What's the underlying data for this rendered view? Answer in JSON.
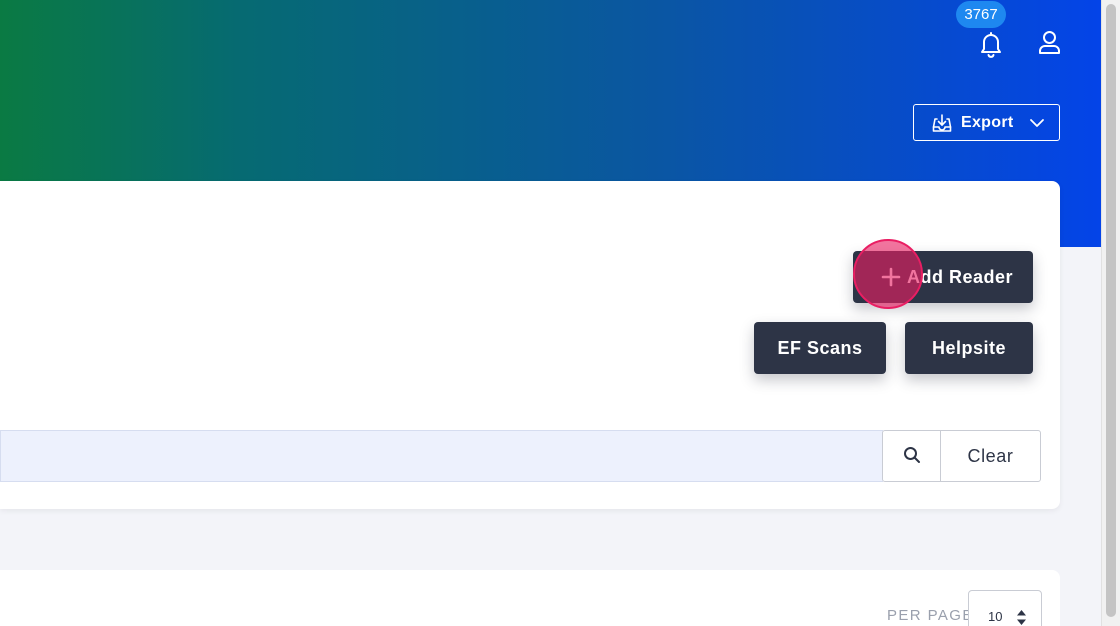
{
  "header": {
    "notification_count": "3767",
    "export_label": "Export"
  },
  "actions": {
    "add_reader_label": "Add Reader",
    "ef_scans_label": "EF Scans",
    "helpsite_label": "Helpsite"
  },
  "search": {
    "value": "",
    "placeholder": "",
    "clear_label": "Clear"
  },
  "pagination": {
    "per_page_label": "PER PAGE",
    "per_page_value": "10"
  },
  "colors": {
    "primary_dark": "#2d3446",
    "badge_blue": "#1e88f0",
    "click_highlight": "#e91e63",
    "search_bg": "#edf1fd"
  },
  "icons": [
    "bell-icon",
    "user-icon",
    "download-icon",
    "chevron-down-icon",
    "plus-icon",
    "search-icon",
    "sort-arrows-icon"
  ]
}
